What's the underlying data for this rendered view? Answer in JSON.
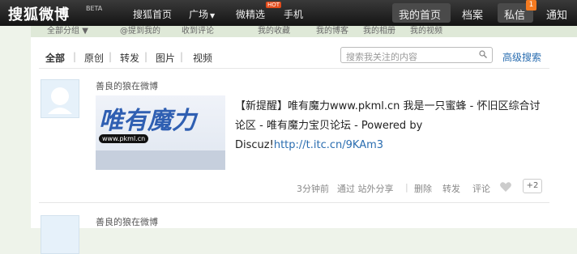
{
  "brand": {
    "logo": "搜狐微博",
    "beta": "BETA"
  },
  "nav": {
    "home": "搜狐首页",
    "square": "广场",
    "selected": "微精选",
    "hot_badge": "HOT",
    "mobile": "手机",
    "my_home": "我的首页",
    "archive": "档案",
    "messages": "私信",
    "message_count": "1",
    "notify": "通知"
  },
  "tabs": [
    "全部分组",
    "@提到我的",
    "收到评论",
    "我的收藏",
    "我的博客",
    "我的相册",
    "我的视频"
  ],
  "filters": [
    "全部",
    "原创",
    "转发",
    "图片",
    "视频"
  ],
  "search": {
    "placeholder": "搜索我关注的内容",
    "advanced": "高级搜索"
  },
  "posts": [
    {
      "author": "善良的狼在微博",
      "thumb_text": "唯有魔力",
      "thumb_url": "www.pkml.cn",
      "text": "【新提醒】唯有魔力www.pkml.cn 我是一只蜜蜂 - 怀旧区综合讨论区 - 唯有魔力宝贝论坛 - Powered by Discuz!",
      "link": "http://t.itc.cn/9KAm3",
      "time": "3分钟前",
      "source": "通过 站外分享",
      "delete": "删除",
      "repost": "转发",
      "comment": "评论",
      "plus": "+2"
    },
    {
      "author": "善良的狼在微博"
    }
  ],
  "colors": {
    "topbar": "#1c1c1c",
    "link": "#2a6db0",
    "accent": "#f47a20"
  }
}
